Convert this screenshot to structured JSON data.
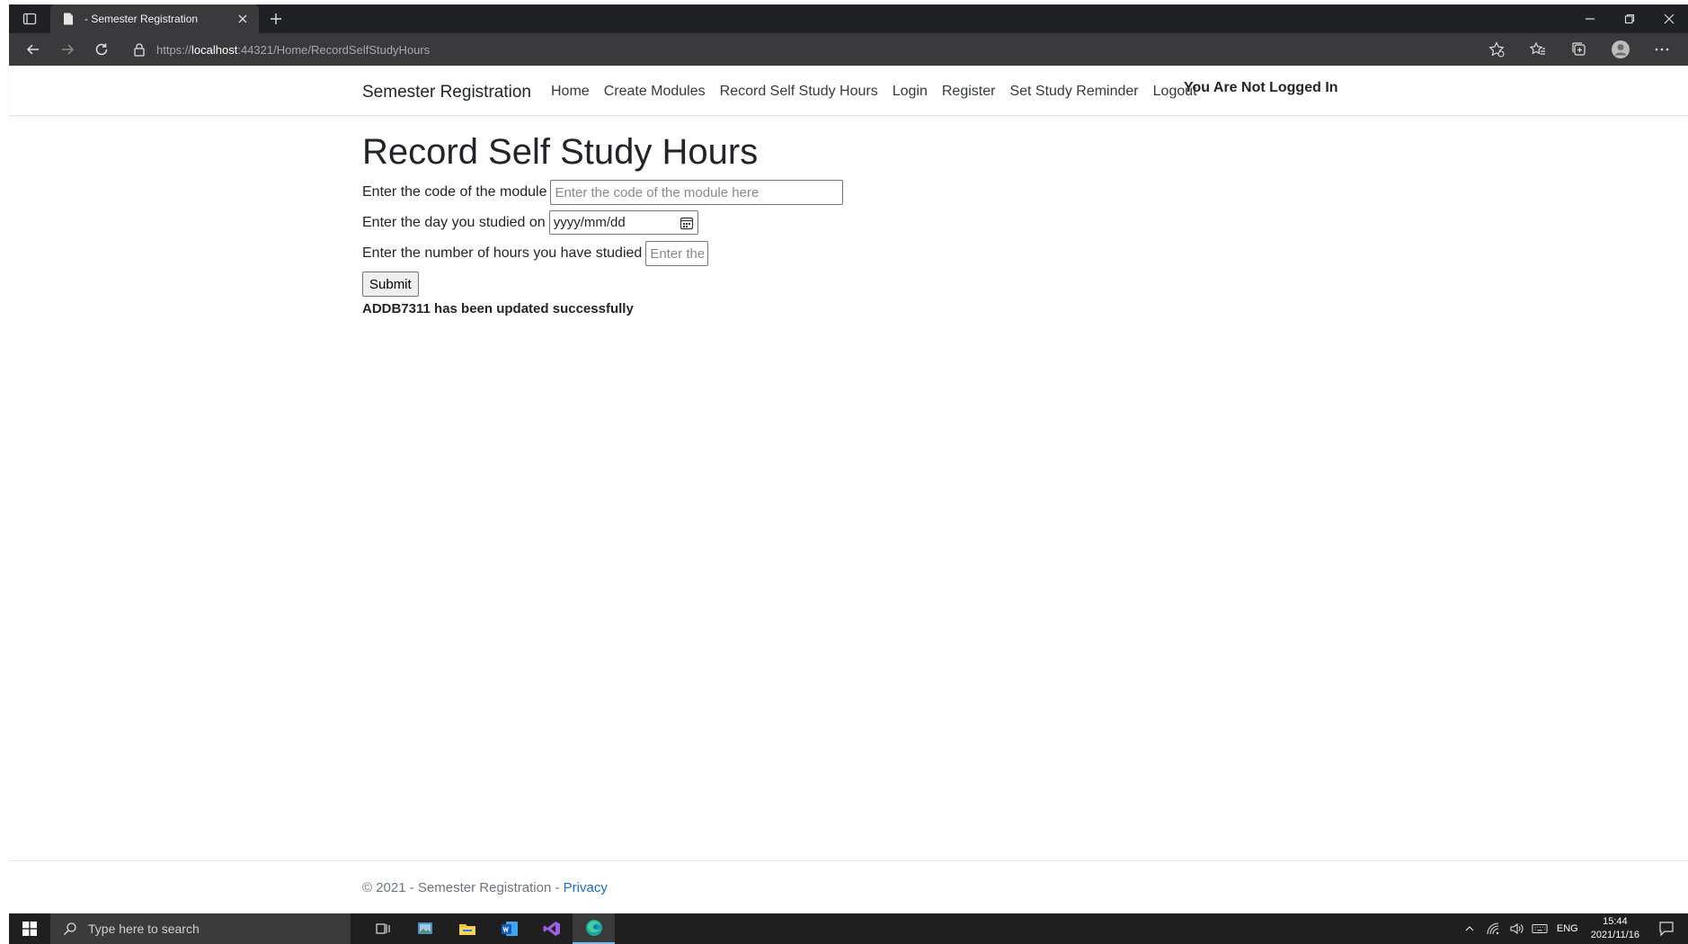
{
  "browser": {
    "tab_title": " - Semester Registration",
    "url_scheme": "https://",
    "url_host": "localhost",
    "url_rest": ":44321/Home/RecordSelfStudyHours"
  },
  "navbar": {
    "brand": "Semester Registration",
    "links": [
      {
        "label": "Home"
      },
      {
        "label": "Create Modules"
      },
      {
        "label": "Record Self Study Hours"
      },
      {
        "label": "Login"
      },
      {
        "label": "Register"
      },
      {
        "label": "Set Study Reminder"
      },
      {
        "label": "Logout"
      }
    ],
    "login_status": "You Are Not Logged In"
  },
  "main": {
    "title": "Record Self Study Hours",
    "module_code": {
      "label": "Enter the code of the module",
      "placeholder": "Enter the code of the module here",
      "value": ""
    },
    "study_date": {
      "label": "Enter the day you studied on",
      "display": "yyyy/mm/dd"
    },
    "hours": {
      "label": "Enter the number of hours you have studied",
      "placeholder": "Enter the number of hours here",
      "value": ""
    },
    "submit_label": "Submit",
    "status_message": "ADDB7311 has been updated successfully"
  },
  "footer": {
    "copyright": "© 2021 - Semester Registration - ",
    "privacy_label": "Privacy"
  },
  "taskbar": {
    "search_placeholder": "Type here to search",
    "language": "ENG",
    "time": "15:44",
    "date": "2021/11/16"
  },
  "colors": {
    "chrome_dark": "#202124",
    "toolbar": "#3a3a3c",
    "link_blue": "#1b6ec2",
    "taskbar": "#1f1f1f"
  },
  "icons": {
    "tab_actions": "tab-actions-icon",
    "favicon": "page-icon",
    "close": "close-icon",
    "new_tab": "plus-icon",
    "back": "back-arrow-icon",
    "forward": "forward-arrow-icon",
    "refresh": "refresh-icon",
    "lock": "lock-icon",
    "calendar": "calendar-icon"
  }
}
